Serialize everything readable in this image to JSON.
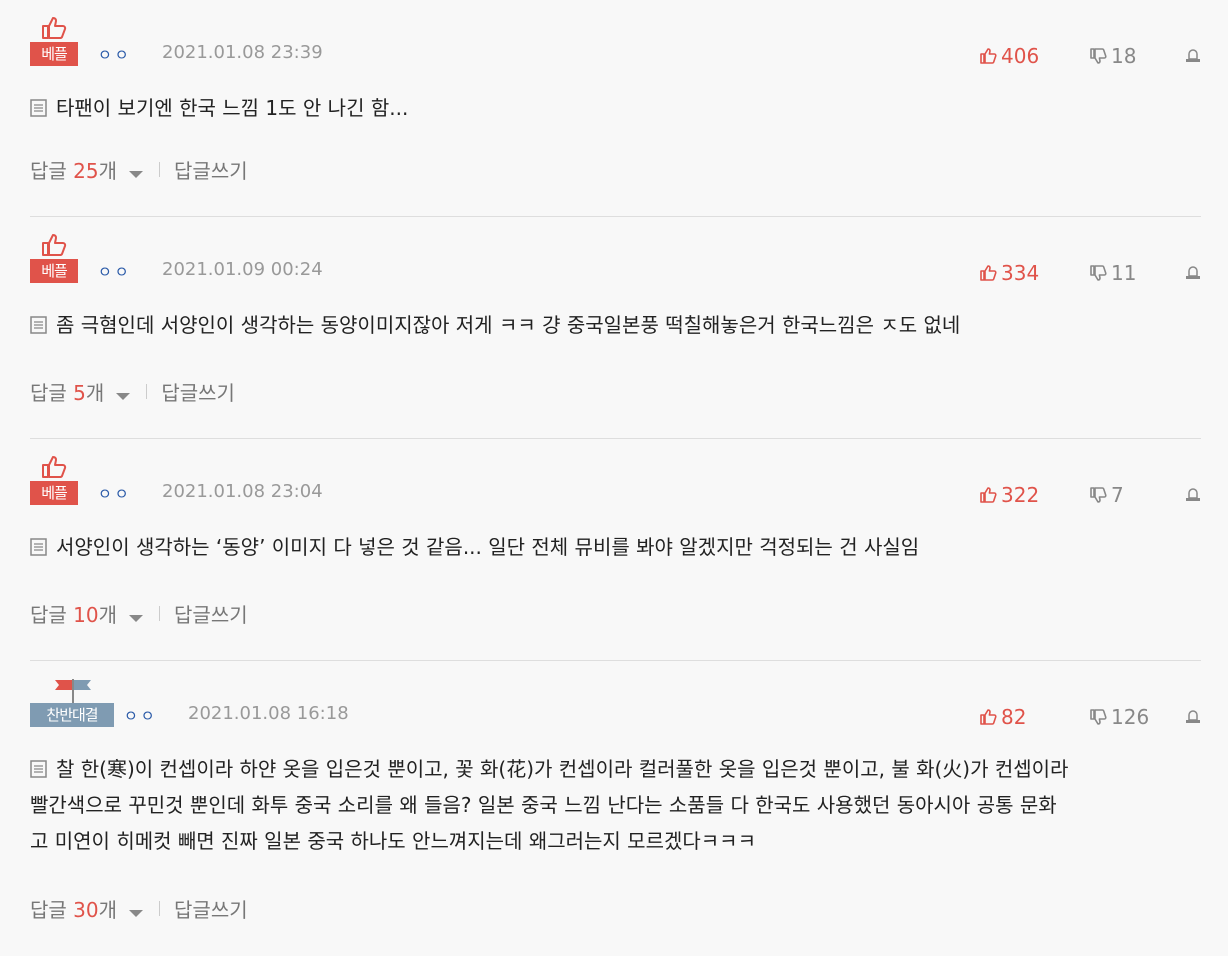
{
  "colors": {
    "accent": "#e0534a",
    "against": "#7f9bb2",
    "user": "#2a5aa8"
  },
  "icons": {
    "thumb": "thumbs-up-icon",
    "flag": "flag-icon",
    "up": "thumbs-up-icon",
    "down": "thumbs-down-icon",
    "report": "report-icon",
    "doc": "document-icon"
  },
  "footer_labels": {
    "reply_prefix": "답글 ",
    "reply_suffix": "개",
    "write_reply": "답글쓰기"
  },
  "comments": [
    {
      "badge": "베플",
      "user": "ㅇㅇ",
      "date": "2021.01.08 23:39",
      "up": "406",
      "down": "18",
      "text": "타팬이 보기엔 한국 느낌 1도 안 나긴 함...",
      "reply_count": "25"
    },
    {
      "badge": "베플",
      "user": "ㅇㅇ",
      "date": "2021.01.09 00:24",
      "up": "334",
      "down": "11",
      "text": "좀 극혐인데 서양인이 생각하는 동양이미지잖아 저게 ㅋㅋ 걍 중국일본풍 떡칠해놓은거 한국느낌은 ㅈ도 없네",
      "reply_count": "5"
    },
    {
      "badge": "베플",
      "user": "ㅇㅇ",
      "date": "2021.01.08 23:04",
      "up": "322",
      "down": "7",
      "text": "서양인이 생각하는 ‘동양’ 이미지 다 넣은 것 같음... 일단 전체 뮤비를 봐야 알겠지만 걱정되는 건 사실임",
      "reply_count": "10"
    },
    {
      "badge": "찬반대결",
      "user": "ㅇㅇ",
      "date": "2021.01.08 16:18",
      "up": "82",
      "down": "126",
      "text_lines": [
        "찰 한(寒)이 컨셉이라 하얀 옷을 입은것 뿐이고, 꽃 화(花)가 컨셉이라 컬러풀한 옷을 입은것 뿐이고, 불 화(火)가 컨셉이라",
        "빨간색으로 꾸민것 뿐인데 화투 중국 소리를 왜 들음? 일본 중국 느낌 난다는 소품들 다 한국도 사용했던 동아시아 공통 문화",
        "고 미연이 히메컷 빼면 진짜 일본 중국 하나도 안느껴지는데 왜그러는지 모르겠다ㅋㅋㅋ"
      ],
      "reply_count": "30"
    }
  ]
}
